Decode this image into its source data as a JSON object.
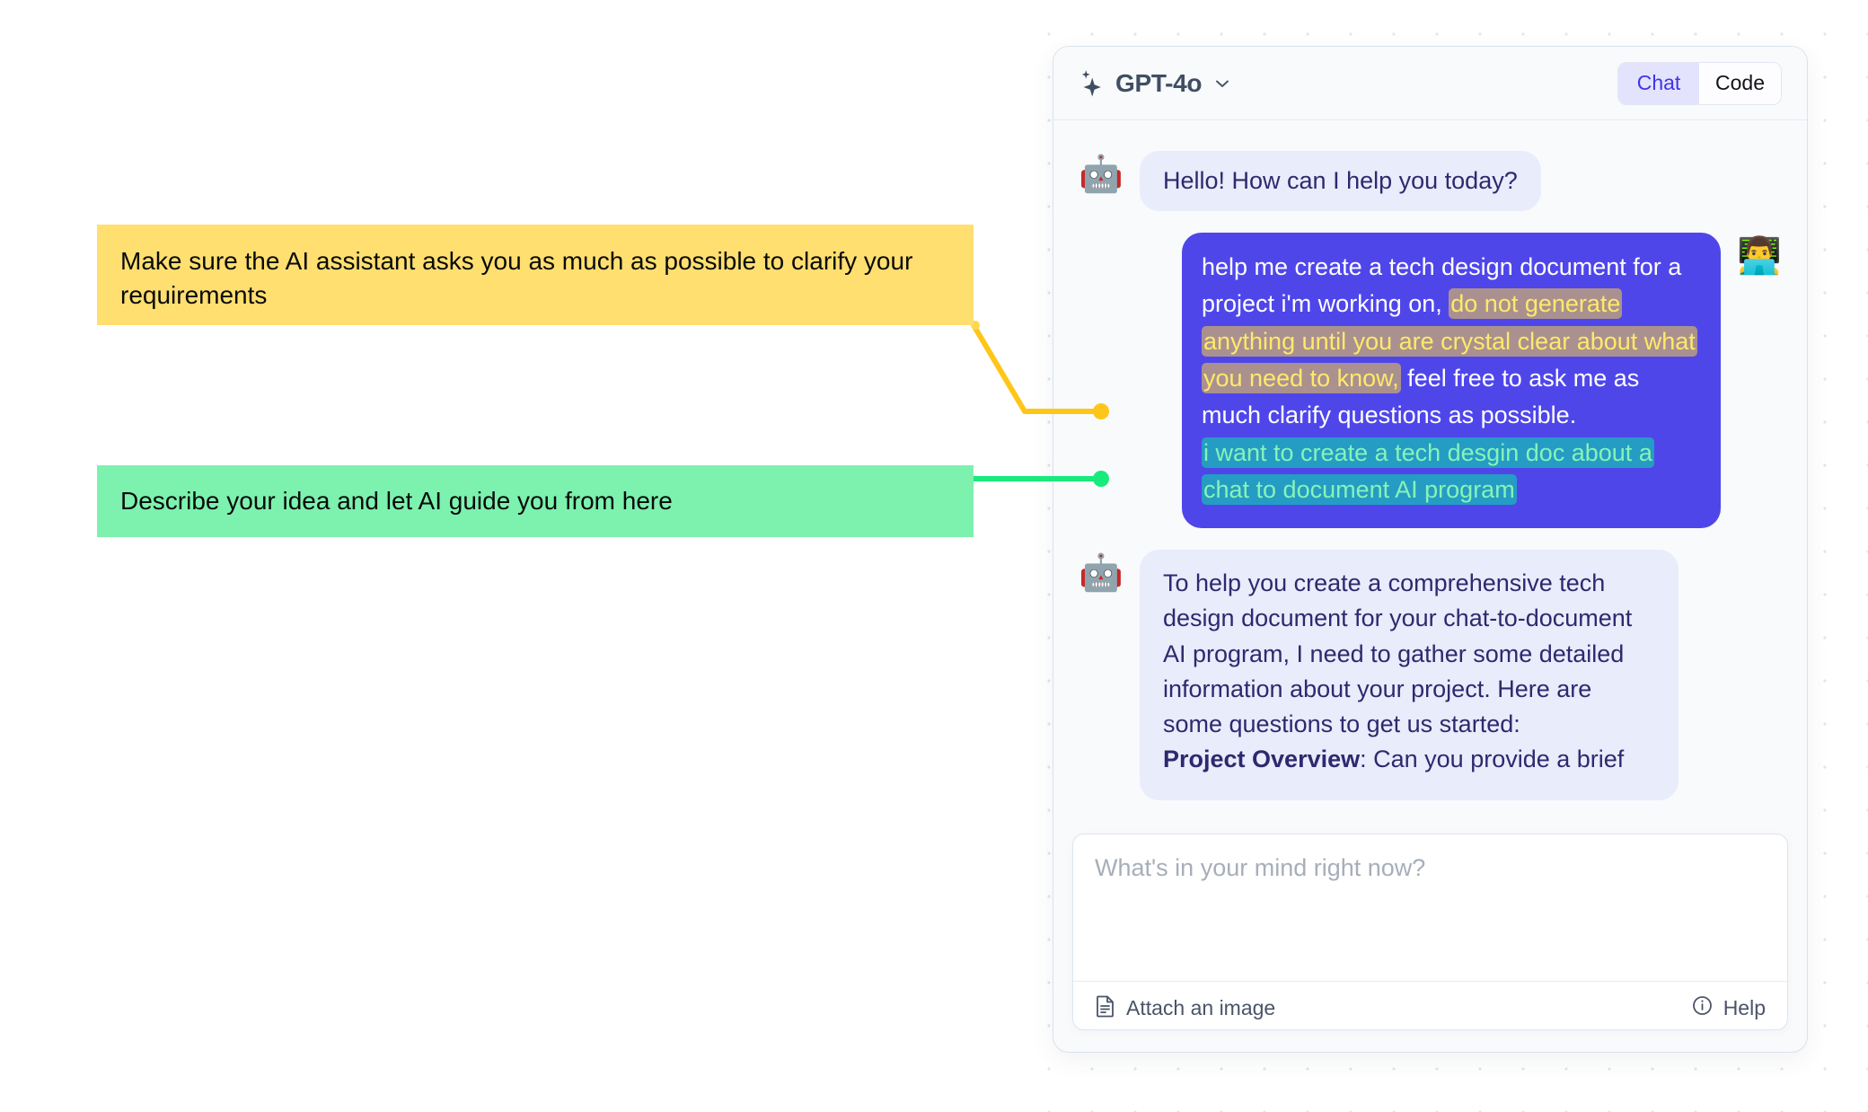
{
  "header": {
    "model_name": "GPT-4o",
    "sparkle_icon": "sparkle-icon",
    "chevron_icon": "chevron-down-icon",
    "tabs": [
      {
        "label": "Chat",
        "active": true
      },
      {
        "label": "Code",
        "active": false
      }
    ]
  },
  "messages": [
    {
      "role": "assistant",
      "avatar": "🤖",
      "text": "Hello! How can I help you today?"
    },
    {
      "role": "user",
      "avatar": "👨‍💻",
      "segments": [
        {
          "text": "help me create a tech design document for a project i'm working on, ",
          "highlight": "none"
        },
        {
          "text": "do not generate anything until you are crystal clear about what you need to know,",
          "highlight": "yellow"
        },
        {
          "text": " feel free to ask me as much clarify questions as possible.",
          "highlight": "none"
        },
        {
          "text": "i want to create a tech desgin doc about a chat to document AI program",
          "highlight": "green"
        }
      ]
    },
    {
      "role": "assistant",
      "avatar": "🤖",
      "text": "To help you create a comprehensive tech design document for your chat-to-document AI program, I need to gather some detailed information about your project. Here are some questions to get us started:",
      "followup_bold": "Project Overview",
      "followup_rest": ": Can you provide a brief"
    }
  ],
  "composer": {
    "placeholder": "What's in your mind right now?",
    "value": "",
    "attach_label": "Attach an image",
    "attach_icon": "document-icon",
    "help_label": "Help",
    "help_icon": "info-circle-icon"
  },
  "annotations": [
    {
      "id": "yellow",
      "text": "Make sure the AI assistant asks you as much as possible to clarify your requirements",
      "color": "#ffdf70",
      "connector_color": "#ffc61a"
    },
    {
      "id": "green",
      "text": "Describe your idea and let AI guide you from here",
      "color": "#7cf2ae",
      "connector_color": "#18ea7c"
    }
  ],
  "colors": {
    "user_bubble": "#4f46ea",
    "bot_bubble": "#e8ecfb",
    "bot_text": "#2c2a6e",
    "accent": "#3f35e8",
    "card_bg": "#f8fafc"
  }
}
